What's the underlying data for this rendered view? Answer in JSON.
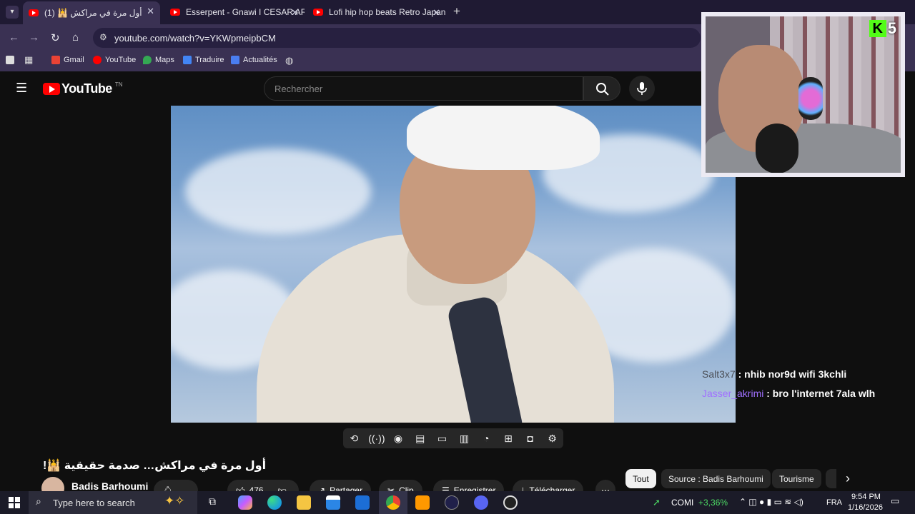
{
  "browser": {
    "tabs": [
      {
        "title": "أول مرة في مراكش 🕌 (1)",
        "active": true
      },
      {
        "title": "Esserpent - Gnawi I CESAR ART",
        "active": false
      },
      {
        "title": "Lofi hip hop beats Retro Japane",
        "active": false
      }
    ],
    "new_tab": "+",
    "address": "youtube.com/watch?v=YKWpmeipbCM",
    "bookmarks": [
      "Gmail",
      "YouTube",
      "Maps",
      "Traduire",
      "Actualités"
    ]
  },
  "youtube": {
    "logo": "YouTube",
    "region": "TN",
    "search_placeholder": "Rechercher",
    "video_title": "أول مرة في مراكش… صدمة حقيقية 🕌!",
    "channel_name": "Badis Barhoumi",
    "likes": "476",
    "actions": [
      "Partager",
      "Clip",
      "Enregistrer",
      "Télécharger"
    ],
    "chips": [
      "Tout",
      "Source : Badis Barhoumi",
      "Tourisme"
    ]
  },
  "stream_overlay": {
    "viewer_count": "5",
    "chat": [
      {
        "user": "Salt3x7",
        "message": " : nhib nor9d wifi 3kchli"
      },
      {
        "user": "Jasser_akrimi",
        "message": " : bro l'internet 7ala wlh"
      }
    ]
  },
  "taskbar": {
    "search_placeholder": "Type here to search",
    "stock_label": "COMI",
    "stock_change": "+3,36%",
    "language": "FRA",
    "time": "9:54 PM",
    "date": "1/16/2026"
  },
  "colors": {
    "accent": "#3a3153",
    "youtube_red": "#ff0000",
    "kick_green": "#53fc18",
    "chat_user2": "#a070ff",
    "stock_green": "#4cd964"
  }
}
